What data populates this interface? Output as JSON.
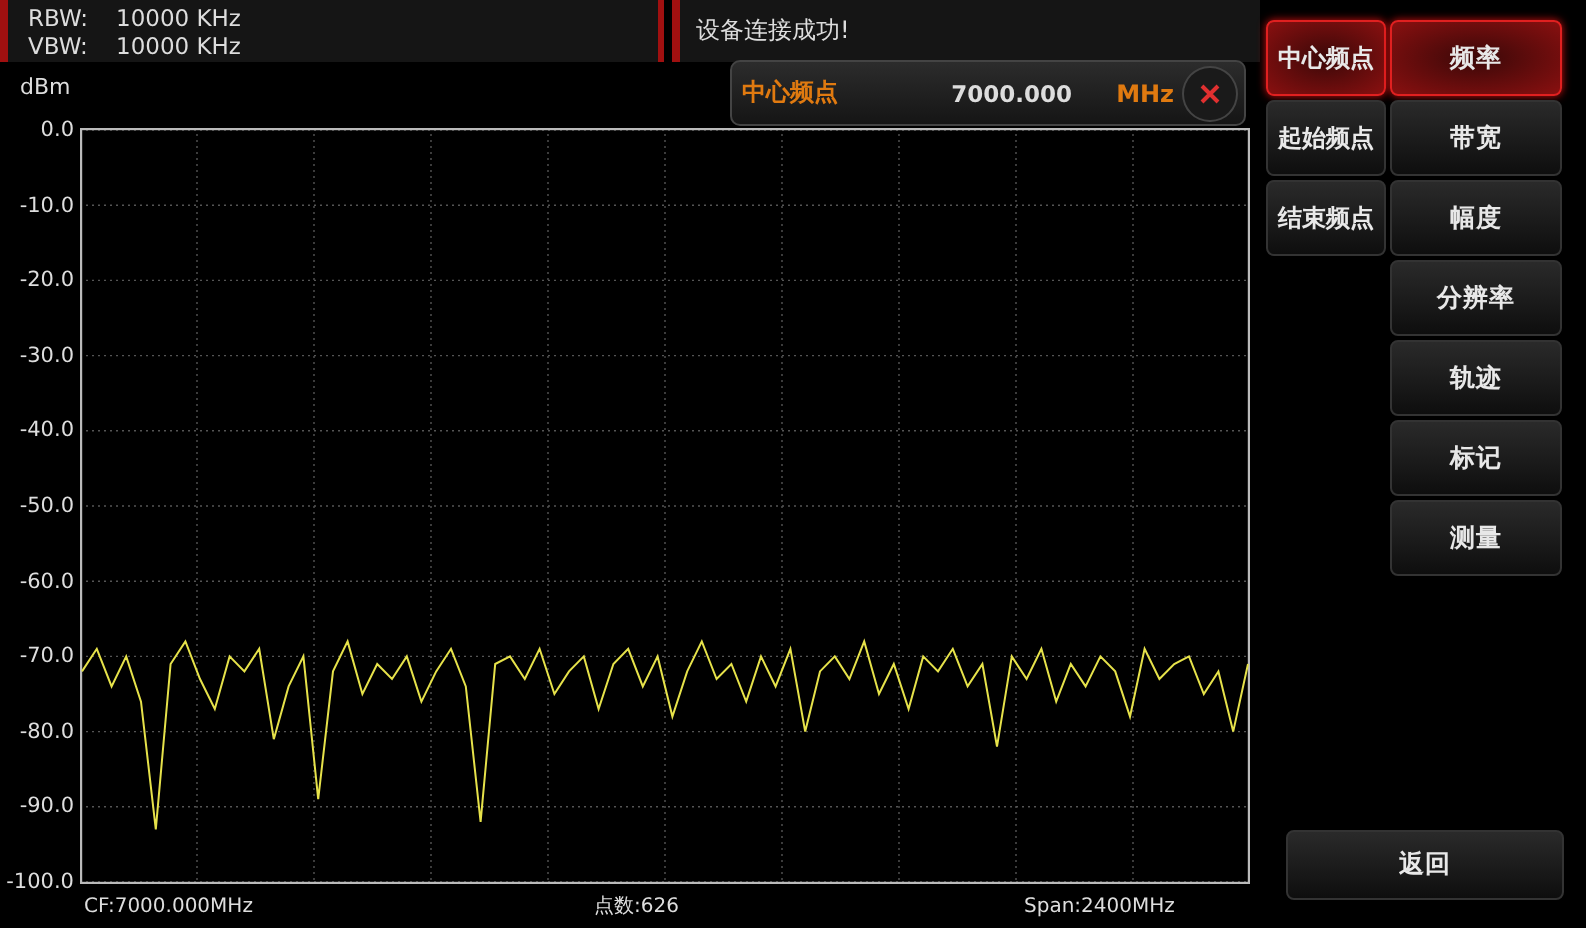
{
  "status": {
    "rbw_label": "RBW:",
    "rbw": "10000 KHz",
    "vbw_label": "VBW:",
    "vbw": "10000 KHz"
  },
  "message": "设备连接成功!",
  "popup": {
    "label": "中心频点",
    "value": "7000.000",
    "unit": "MHz"
  },
  "chart_data": {
    "type": "line",
    "grid": true,
    "ylabel": "dBm",
    "ylim": [
      -100,
      0
    ],
    "yticks": [
      {
        "value": 0,
        "label": "0.0"
      },
      {
        "value": -10,
        "label": "-10.0"
      },
      {
        "value": -20,
        "label": "-20.0"
      },
      {
        "value": -30,
        "label": "-30.0"
      },
      {
        "value": -40,
        "label": "-40.0"
      },
      {
        "value": -50,
        "label": "-50.0"
      },
      {
        "value": -60,
        "label": "-60.0"
      },
      {
        "value": -70,
        "label": "-70.0"
      },
      {
        "value": -80,
        "label": "-80.0"
      },
      {
        "value": -90,
        "label": "-90.0"
      },
      {
        "value": -100,
        "label": "-100.0"
      }
    ],
    "series": [
      {
        "color": "#e6e24a",
        "values": [
          -72,
          -69,
          -74,
          -70,
          -76,
          -93,
          -71,
          -68,
          -73,
          -77,
          -70,
          -72,
          -69,
          -81,
          -74,
          -70,
          -89,
          -72,
          -68,
          -75,
          -71,
          -73,
          -70,
          -76,
          -72,
          -69,
          -74,
          -92,
          -71,
          -70,
          -73,
          -69,
          -75,
          -72,
          -70,
          -77,
          -71,
          -69,
          -74,
          -70,
          -78,
          -72,
          -68,
          -73,
          -71,
          -76,
          -70,
          -74,
          -69,
          -80,
          -72,
          -70,
          -73,
          -68,
          -75,
          -71,
          -77,
          -70,
          -72,
          -69,
          -74,
          -71,
          -82,
          -70,
          -73,
          -69,
          -76,
          -71,
          -74,
          -70,
          -72,
          -78,
          -69,
          -73,
          -71,
          -70,
          -75,
          -72,
          -80,
          -71
        ]
      }
    ]
  },
  "footer": {
    "center_freq": "CF:7000.000MHz",
    "points": "点数:626",
    "span": "Span:2400MHz"
  },
  "sub_menu": [
    {
      "label": "中心频点",
      "selected": true
    },
    {
      "label": "起始频点",
      "selected": false
    },
    {
      "label": "结束频点",
      "selected": false
    }
  ],
  "main_menu": [
    {
      "label": "频率",
      "selected": true
    },
    {
      "label": "带宽",
      "selected": false
    },
    {
      "label": "幅度",
      "selected": false
    },
    {
      "label": "分辨率",
      "selected": false
    },
    {
      "label": "轨迹",
      "selected": false
    },
    {
      "label": "标记",
      "selected": false
    },
    {
      "label": "测量",
      "selected": false
    }
  ],
  "back_button": "返回"
}
